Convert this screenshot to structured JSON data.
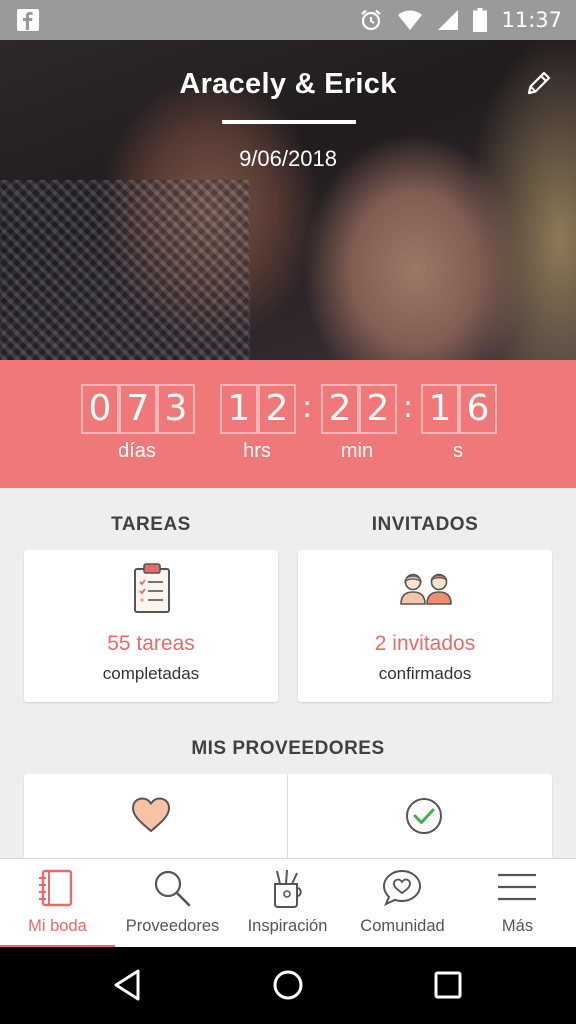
{
  "status_bar": {
    "time": "11:37",
    "left_icon": "facebook-icon",
    "right_icons": [
      "alarm-icon",
      "wifi-icon",
      "signal-icon",
      "battery-icon"
    ]
  },
  "hero": {
    "couple_names": "Aracely & Erick",
    "wedding_date": "9/06/2018",
    "edit_icon": "pencil-icon"
  },
  "countdown": {
    "days": [
      "0",
      "7",
      "3"
    ],
    "hours": [
      "1",
      "2"
    ],
    "minutes": [
      "2",
      "2"
    ],
    "seconds": [
      "1",
      "6"
    ],
    "separator": ":",
    "labels": {
      "days": "días",
      "hours": "hrs",
      "minutes": "min",
      "seconds": "s"
    },
    "background_color": "#f17878"
  },
  "tasks": {
    "title": "TAREAS",
    "value": "55 tareas",
    "subtitle": "completadas",
    "icon": "clipboard-checklist-icon"
  },
  "guests": {
    "title": "INVITADOS",
    "value": "2 invitados",
    "subtitle": "confirmados",
    "icon": "guests-couple-icon"
  },
  "vendors": {
    "title": "MIS PROVEEDORES",
    "cards": [
      {
        "icon": "heart-icon"
      },
      {
        "icon": "check-circle-icon"
      }
    ]
  },
  "bottom_nav": {
    "accent_color": "#e86b6b",
    "items": [
      {
        "label": "Mi boda",
        "icon": "notebook-icon",
        "active": true
      },
      {
        "label": "Proveedores",
        "icon": "search-icon",
        "active": false
      },
      {
        "label": "Inspiración",
        "icon": "pencil-cup-icon",
        "active": false
      },
      {
        "label": "Comunidad",
        "icon": "chat-heart-icon",
        "active": false
      },
      {
        "label": "Más",
        "icon": "menu-icon",
        "active": false
      }
    ]
  },
  "system_nav": {
    "buttons": [
      "back-icon",
      "home-icon",
      "recents-icon"
    ]
  }
}
